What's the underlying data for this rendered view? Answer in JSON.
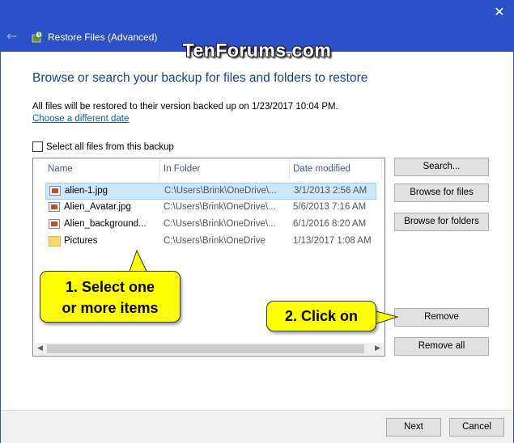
{
  "window": {
    "title": "Restore Files (Advanced)",
    "watermark": "TenForums.com",
    "close_glyph": "✕",
    "back_glyph": "←"
  },
  "main": {
    "heading": "Browse or search your backup for files and folders to restore",
    "info": "All files will be restored to their version backed up on 1/23/2017 10:04 PM.",
    "choose_link": "Choose a different date",
    "select_all_label": "Select all files from this backup"
  },
  "list": {
    "columns": [
      "Name",
      "In Folder",
      "Date modified"
    ],
    "rows": [
      {
        "name": "alien-1.jpg",
        "folder": "C:\\Users\\Brink\\OneDrive\\...",
        "date": "3/1/2013 2:56 AM",
        "type": "image",
        "selected": true
      },
      {
        "name": "Alien_Avatar.jpg",
        "folder": "C:\\Users\\Brink\\OneDrive\\...",
        "date": "5/6/2013 7:16 AM",
        "type": "image",
        "selected": false
      },
      {
        "name": "Alien_background...",
        "folder": "C:\\Users\\Brink\\OneDrive\\...",
        "date": "6/1/2016 8:20 AM",
        "type": "image",
        "selected": false
      },
      {
        "name": "Pictures",
        "folder": "C:\\Users\\Brink\\OneDrive",
        "date": "1/13/2017 1:08 AM",
        "type": "folder",
        "selected": false
      }
    ]
  },
  "buttons": {
    "search": "Search...",
    "browse_files": "Browse for files",
    "browse_folders": "Browse for folders",
    "remove": "Remove",
    "remove_all": "Remove all",
    "next": "Next",
    "cancel": "Cancel"
  },
  "callouts": {
    "step1_line1": "1. Select one",
    "step1_line2": "or more items",
    "step2": "2. Click on"
  },
  "colors": {
    "title_bar": "#2b50c8",
    "heading": "#1e3c9a",
    "link": "#0f5ea8",
    "selection": "#cce8ff",
    "callout": "#ffff00"
  }
}
